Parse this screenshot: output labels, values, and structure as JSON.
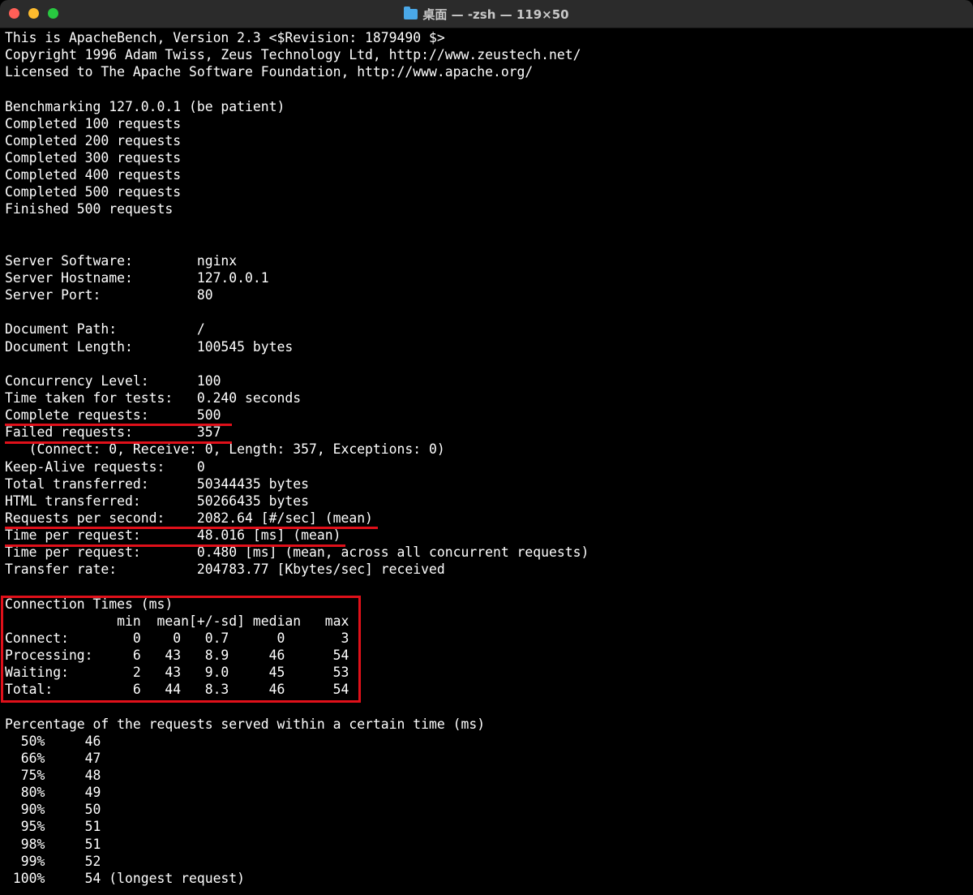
{
  "window": {
    "title": "桌面 — -zsh — 119×50",
    "accent_color": "#e0101a"
  },
  "terminal": {
    "lines": [
      "This is ApacheBench, Version 2.3 <$Revision: 1879490 $>",
      "Copyright 1996 Adam Twiss, Zeus Technology Ltd, http://www.zeustech.net/",
      "Licensed to The Apache Software Foundation, http://www.apache.org/",
      "",
      "Benchmarking 127.0.0.1 (be patient)",
      "Completed 100 requests",
      "Completed 200 requests",
      "Completed 300 requests",
      "Completed 400 requests",
      "Completed 500 requests",
      "Finished 500 requests",
      "",
      "",
      "Server Software:        nginx",
      "Server Hostname:        127.0.0.1",
      "Server Port:            80",
      "",
      "Document Path:          /",
      "Document Length:        100545 bytes",
      "",
      "Concurrency Level:      100",
      "Time taken for tests:   0.240 seconds",
      "Complete requests:      500",
      "Failed requests:        357",
      "   (Connect: 0, Receive: 0, Length: 357, Exceptions: 0)",
      "Keep-Alive requests:    0",
      "Total transferred:      50344435 bytes",
      "HTML transferred:       50266435 bytes",
      "Requests per second:    2082.64 [#/sec] (mean)",
      "Time per request:       48.016 [ms] (mean)",
      "Time per request:       0.480 [ms] (mean, across all concurrent requests)",
      "Transfer rate:          204783.77 [Kbytes/sec] received",
      "",
      "Connection Times (ms)",
      "              min  mean[+/-sd] median   max",
      "Connect:        0    0   0.7      0       3",
      "Processing:     6   43   8.9     46      54",
      "Waiting:        2   43   9.0     45      53",
      "Total:          6   44   8.3     46      54",
      "",
      "Percentage of the requests served within a certain time (ms)",
      "  50%     46",
      "  66%     47",
      "  75%     48",
      "  80%     49",
      "  90%     50",
      "  95%     51",
      "  98%     51",
      "  99%     52",
      " 100%     54 (longest request)"
    ]
  }
}
